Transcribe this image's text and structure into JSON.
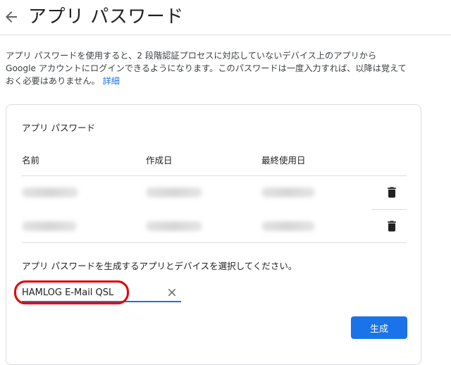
{
  "header": {
    "back_icon": "arrow-left-icon",
    "title": "アプリ パスワード"
  },
  "description": {
    "line1": "アプリ パスワードを使用すると、2 段階認証プロセスに対応していないデバイス上のアプリから",
    "line2": "Google アカウントにログインできるようになります。このパスワードは一度入力すれば、以降は覚えて",
    "line3": "おく必要はありません。",
    "link": "詳細"
  },
  "card": {
    "title": "アプリ パスワード",
    "columns": [
      "名前",
      "作成日",
      "最終使用日"
    ],
    "rows": [
      {
        "delete_icon": "trash-icon"
      },
      {
        "delete_icon": "trash-icon"
      }
    ],
    "prompt": "アプリ パスワードを生成するアプリとデバイスを選択してください。",
    "input": {
      "value": "HAMLOG E-Mail QSL",
      "clear_icon": "close-icon"
    },
    "generate_label": "生成"
  },
  "colors": {
    "accent": "#1a73e8",
    "highlight": "#e00000",
    "divider": "#dadce0"
  }
}
